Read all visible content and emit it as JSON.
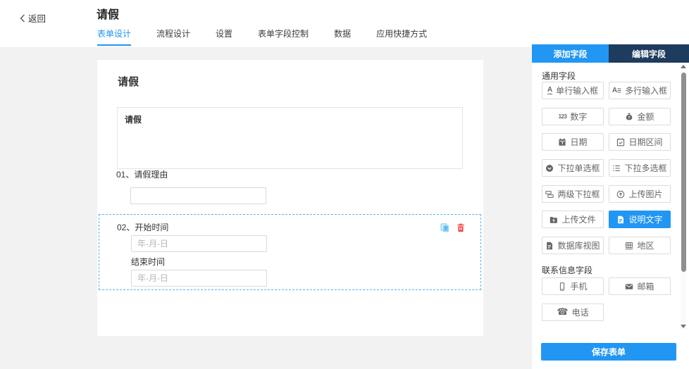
{
  "header": {
    "back_label": "返回",
    "title": "请假",
    "tabs": [
      {
        "label": "表单设计",
        "active": true
      },
      {
        "label": "流程设计"
      },
      {
        "label": "设置"
      },
      {
        "label": "表单字段控制"
      },
      {
        "label": "数据"
      },
      {
        "label": "应用快捷方式"
      }
    ]
  },
  "canvas": {
    "form_title": "请假",
    "form_description": "请假",
    "fields": [
      {
        "number": "01、",
        "label": "请假理由"
      },
      {
        "number": "02、",
        "label": "开始时间",
        "placeholder": "年-月-日",
        "end_label": "结束时间",
        "end_placeholder": "年-月-日",
        "selected": true
      }
    ]
  },
  "sidebar": {
    "tab_add": "添加字段",
    "tab_edit": "编辑字段",
    "general_section_title": "通用字段",
    "contact_section_title": "联系信息字段",
    "general_fields": [
      {
        "label": "单行输入框"
      },
      {
        "label": "多行输入框"
      },
      {
        "label": "数字"
      },
      {
        "label": "金额"
      },
      {
        "label": "日期"
      },
      {
        "label": "日期区间"
      },
      {
        "label": "下拉单选框"
      },
      {
        "label": "下拉多选框"
      },
      {
        "label": "两级下拉框"
      },
      {
        "label": "上传图片"
      },
      {
        "label": "上传文件"
      },
      {
        "label": "说明文字",
        "active": true
      },
      {
        "label": "数据库视图"
      },
      {
        "label": "地区"
      }
    ],
    "contact_fields": [
      {
        "label": "手机"
      },
      {
        "label": "邮箱"
      },
      {
        "label": "电话"
      }
    ],
    "save_button_label": "保存表单"
  },
  "icons": {
    "single_line_glyph": "A",
    "multi_line_glyph": "A",
    "number_glyph": "123",
    "phone_glyph": "☎"
  },
  "colors": {
    "accent_blue": "#2196f3",
    "dark_tab_blue": "#1d3c5e",
    "selection_dash_blue": "#55b5ef",
    "danger_red": "#ef4444",
    "page_background_gray": "#f2f2f2"
  }
}
